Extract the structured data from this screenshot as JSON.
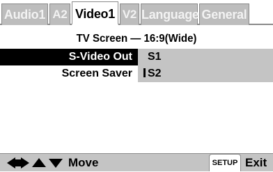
{
  "tabs": [
    {
      "label": "Audio1",
      "active": false
    },
    {
      "label": "A2",
      "active": false
    },
    {
      "label": "Video1",
      "active": true
    },
    {
      "label": "V2",
      "active": false
    },
    {
      "label": "Language",
      "active": false
    },
    {
      "label": "General",
      "active": false
    }
  ],
  "title": "TV Screen — 16:9(Wide)",
  "settings": [
    {
      "label": "S-Video Out",
      "value": "S1"
    },
    {
      "label": "Screen Saver",
      "value": "S2"
    }
  ],
  "footer": {
    "arrows_icon": "direction-arrows-icon",
    "move_label": "Move",
    "setup_button": "SETUP",
    "exit_label": "Exit"
  },
  "colors": {
    "tab_inactive": "#bdbdbd",
    "panel_gray": "#c4c4c4",
    "selected_bg": "#000000",
    "border": "#8a8a8a"
  }
}
